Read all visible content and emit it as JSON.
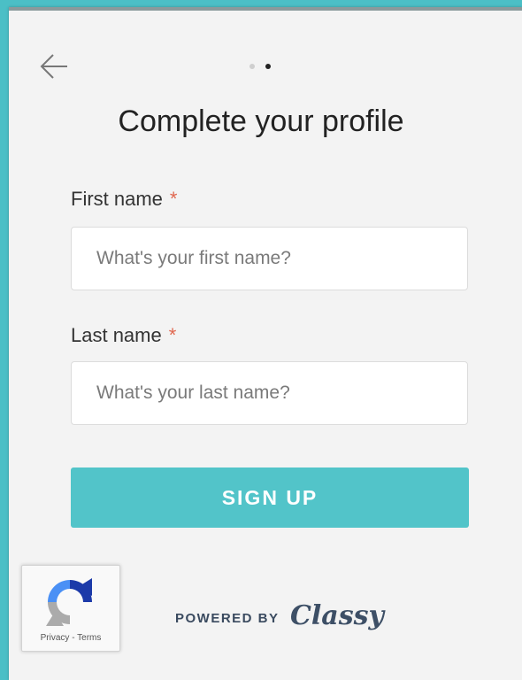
{
  "header": {
    "back_icon": "arrow-left-icon",
    "steps": 2,
    "current_step": 2
  },
  "title": "Complete your profile",
  "form": {
    "first_name": {
      "label": "First name",
      "required_mark": "*",
      "placeholder": "What's your first name?",
      "value": ""
    },
    "last_name": {
      "label": "Last name",
      "required_mark": "*",
      "placeholder": "What's your last name?",
      "value": ""
    },
    "submit_label": "SIGN UP"
  },
  "recaptcha": {
    "links": "Privacy - Terms"
  },
  "footer": {
    "powered_by": "POWERED BY",
    "brand": "Classy"
  },
  "colors": {
    "page_bg": "#4bbfc6",
    "accent": "#52c4c9",
    "required": "#e0674f"
  }
}
